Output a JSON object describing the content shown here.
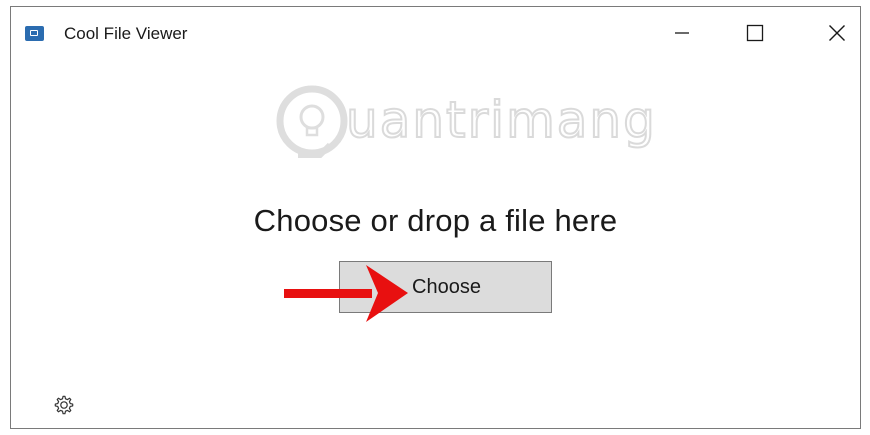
{
  "window": {
    "title": "Cool File Viewer",
    "icon": "app-icon",
    "controls": {
      "minimize": "minimize-icon",
      "maximize": "maximize-icon",
      "close": "close-icon"
    }
  },
  "watermark": {
    "text": "uantrimang",
    "icon": "lightbulb-icon"
  },
  "main": {
    "prompt": "Choose or drop a file here",
    "choose_label": "Choose"
  },
  "annotation": {
    "icon": "red-arrow-icon",
    "color": "#e81010"
  },
  "footer": {
    "icon": "gear-icon"
  }
}
